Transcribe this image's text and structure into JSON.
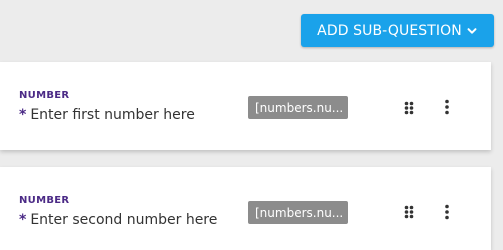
{
  "toolbar": {
    "add_button_label": "ADD SUB-QUESTION"
  },
  "questions": [
    {
      "type_label": "NUMBER",
      "required_marker": "*",
      "prompt": "Enter first number here",
      "tag": "[numbers.nu..."
    },
    {
      "type_label": "NUMBER",
      "required_marker": "*",
      "prompt": "Enter second number here",
      "tag": "[numbers.nu..."
    }
  ],
  "colors": {
    "button": "#1aa2ea",
    "label_purple": "#4b2a86",
    "tag_bg": "#8c8c8c",
    "page_bg": "#ececec"
  },
  "icons": {
    "button_dropdown": "chevron-down-icon",
    "drag_handle": "drag-handle-icon",
    "more_menu": "more-vertical-icon"
  }
}
